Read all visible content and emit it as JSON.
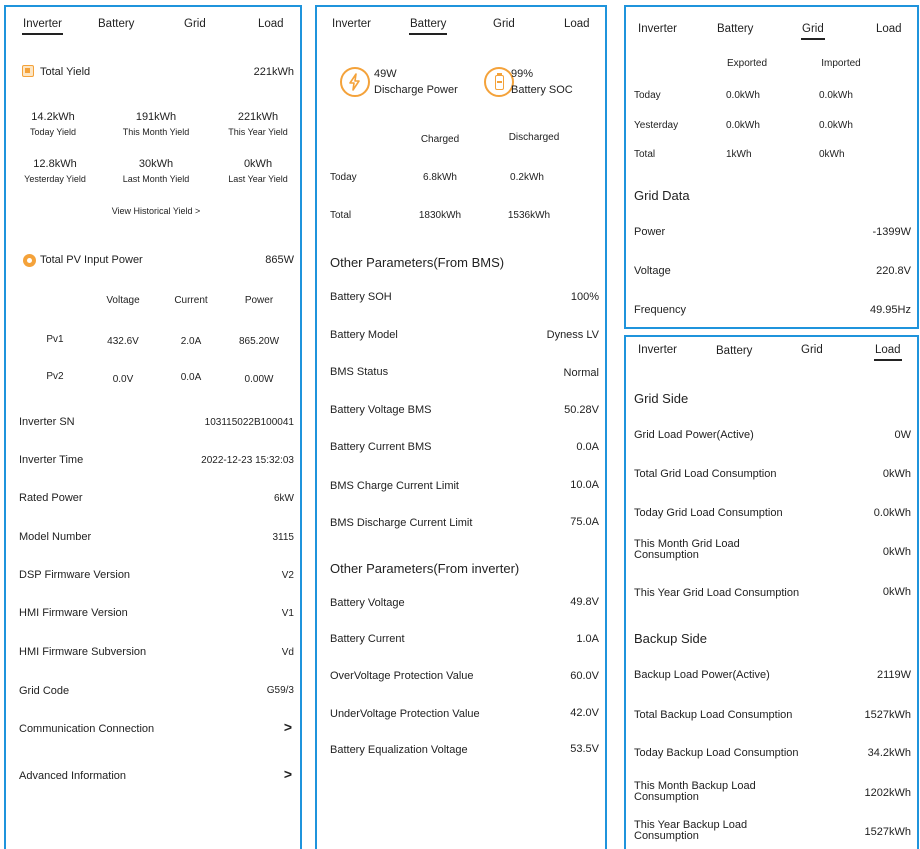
{
  "tabs": [
    "Inverter",
    "Battery",
    "Grid",
    "Load"
  ],
  "colors": {
    "panel_border": "#1f94dc",
    "accent_orange": "#f4a23a"
  },
  "inverter": {
    "total_yield": {
      "label": "Total Yield",
      "value": "221kWh",
      "icon": "yield-icon"
    },
    "yields": [
      {
        "value": "14.2kWh",
        "label": "Today Yield"
      },
      {
        "value": "191kWh",
        "label": "This Month Yield"
      },
      {
        "value": "221kWh",
        "label": "This Year Yield"
      },
      {
        "value": "12.8kWh",
        "label": "Yesterday Yield"
      },
      {
        "value": "30kWh",
        "label": "Last Month Yield"
      },
      {
        "value": "0kWh",
        "label": "Last Year Yield"
      }
    ],
    "view_history": "View Historical Yield >",
    "pv": {
      "label": "Total PV Input Power",
      "value": "865W",
      "icon": "sun-icon"
    },
    "pv_headers": [
      "Voltage",
      "Current",
      "Power"
    ],
    "pv_rows": [
      {
        "name": "Pv1",
        "voltage": "432.6V",
        "current": "2.0A",
        "power": "865.20W"
      },
      {
        "name": "Pv2",
        "voltage": "0.0V",
        "current": "0.0A",
        "power": "0.00W"
      }
    ],
    "info": [
      {
        "label": "Inverter SN",
        "value": "103115022B100041"
      },
      {
        "label": "Inverter Time",
        "value": "2022-12-23 15:32:03"
      },
      {
        "label": "Rated Power",
        "value": "6kW"
      },
      {
        "label": "Model Number",
        "value": "3115"
      },
      {
        "label": "DSP Firmware Version",
        "value": "V2"
      },
      {
        "label": "HMI Firmware Version",
        "value": "V1"
      },
      {
        "label": "HMI Firmware Subversion",
        "value": "Vd"
      },
      {
        "label": "Grid Code",
        "value": "G59/3"
      }
    ],
    "links": [
      {
        "label": "Communication Connection",
        "arrow": ">"
      },
      {
        "label": "Advanced Information",
        "arrow": ">"
      }
    ]
  },
  "battery": {
    "discharge": {
      "value": "49W",
      "label": "Discharge Power",
      "icon": "lightning-icon"
    },
    "soc": {
      "value": "99%",
      "label": "Battery SOC",
      "icon": "battery-icon"
    },
    "energy_headers": [
      "Charged",
      "Discharged"
    ],
    "energy_rows": [
      {
        "label": "Today",
        "charged": "6.8kWh",
        "discharged": "0.2kWh"
      },
      {
        "label": "Total",
        "charged": "1830kWh",
        "discharged": "1536kWh"
      }
    ],
    "bms_title": "Other Parameters(From BMS)",
    "bms": [
      {
        "label": "Battery SOH",
        "value": "100%"
      },
      {
        "label": "Battery Model",
        "value": "Dyness LV"
      },
      {
        "label": "BMS Status",
        "value": "Normal"
      },
      {
        "label": "Battery Voltage BMS",
        "value": "50.28V"
      },
      {
        "label": "Battery Current BMS",
        "value": "0.0A"
      },
      {
        "label": "BMS Charge Current Limit",
        "value": "10.0A"
      },
      {
        "label": "BMS Discharge Current Limit",
        "value": "75.0A"
      }
    ],
    "inv_title": "Other Parameters(From inverter)",
    "inv": [
      {
        "label": "Battery Voltage",
        "value": "49.8V"
      },
      {
        "label": "Battery Current",
        "value": "1.0A"
      },
      {
        "label": "OverVoltage Protection Value",
        "value": "60.0V"
      },
      {
        "label": "UnderVoltage Protection Value",
        "value": "42.0V"
      },
      {
        "label": "Battery Equalization Voltage",
        "value": "53.5V"
      }
    ]
  },
  "grid": {
    "headers": [
      "Exported",
      "Imported"
    ],
    "rows": [
      {
        "label": "Today",
        "exported": "0.0kWh",
        "imported": "0.0kWh"
      },
      {
        "label": "Yesterday",
        "exported": "0.0kWh",
        "imported": "0.0kWh"
      },
      {
        "label": "Total",
        "exported": "1kWh",
        "imported": "0kWh"
      }
    ],
    "data_title": "Grid Data",
    "data": [
      {
        "label": "Power",
        "value": "-1399W"
      },
      {
        "label": "Voltage",
        "value": "220.8V"
      },
      {
        "label": "Frequency",
        "value": "49.95Hz"
      }
    ]
  },
  "load": {
    "grid_side_title": "Grid Side",
    "grid_side": [
      {
        "label": "Grid Load Power(Active)",
        "value": "0W"
      },
      {
        "label": "Total Grid Load Consumption",
        "value": "0kWh"
      },
      {
        "label": "Today Grid Load Consumption",
        "value": "0.0kWh"
      },
      {
        "label": "This Month Grid Load Consumption",
        "value": "0kWh"
      },
      {
        "label": "This Year Grid Load Consumption",
        "value": "0kWh"
      }
    ],
    "backup_side_title": "Backup Side",
    "backup_side": [
      {
        "label": "Backup Load Power(Active)",
        "value": "2119W"
      },
      {
        "label": "Total Backup Load Consumption",
        "value": "1527kWh"
      },
      {
        "label": "Today Backup Load Consumption",
        "value": "34.2kWh"
      },
      {
        "label": "This Month Backup Load Consumption",
        "value": "1202kWh"
      },
      {
        "label": "This Year Backup Load Consumption",
        "value": "1527kWh"
      }
    ]
  }
}
